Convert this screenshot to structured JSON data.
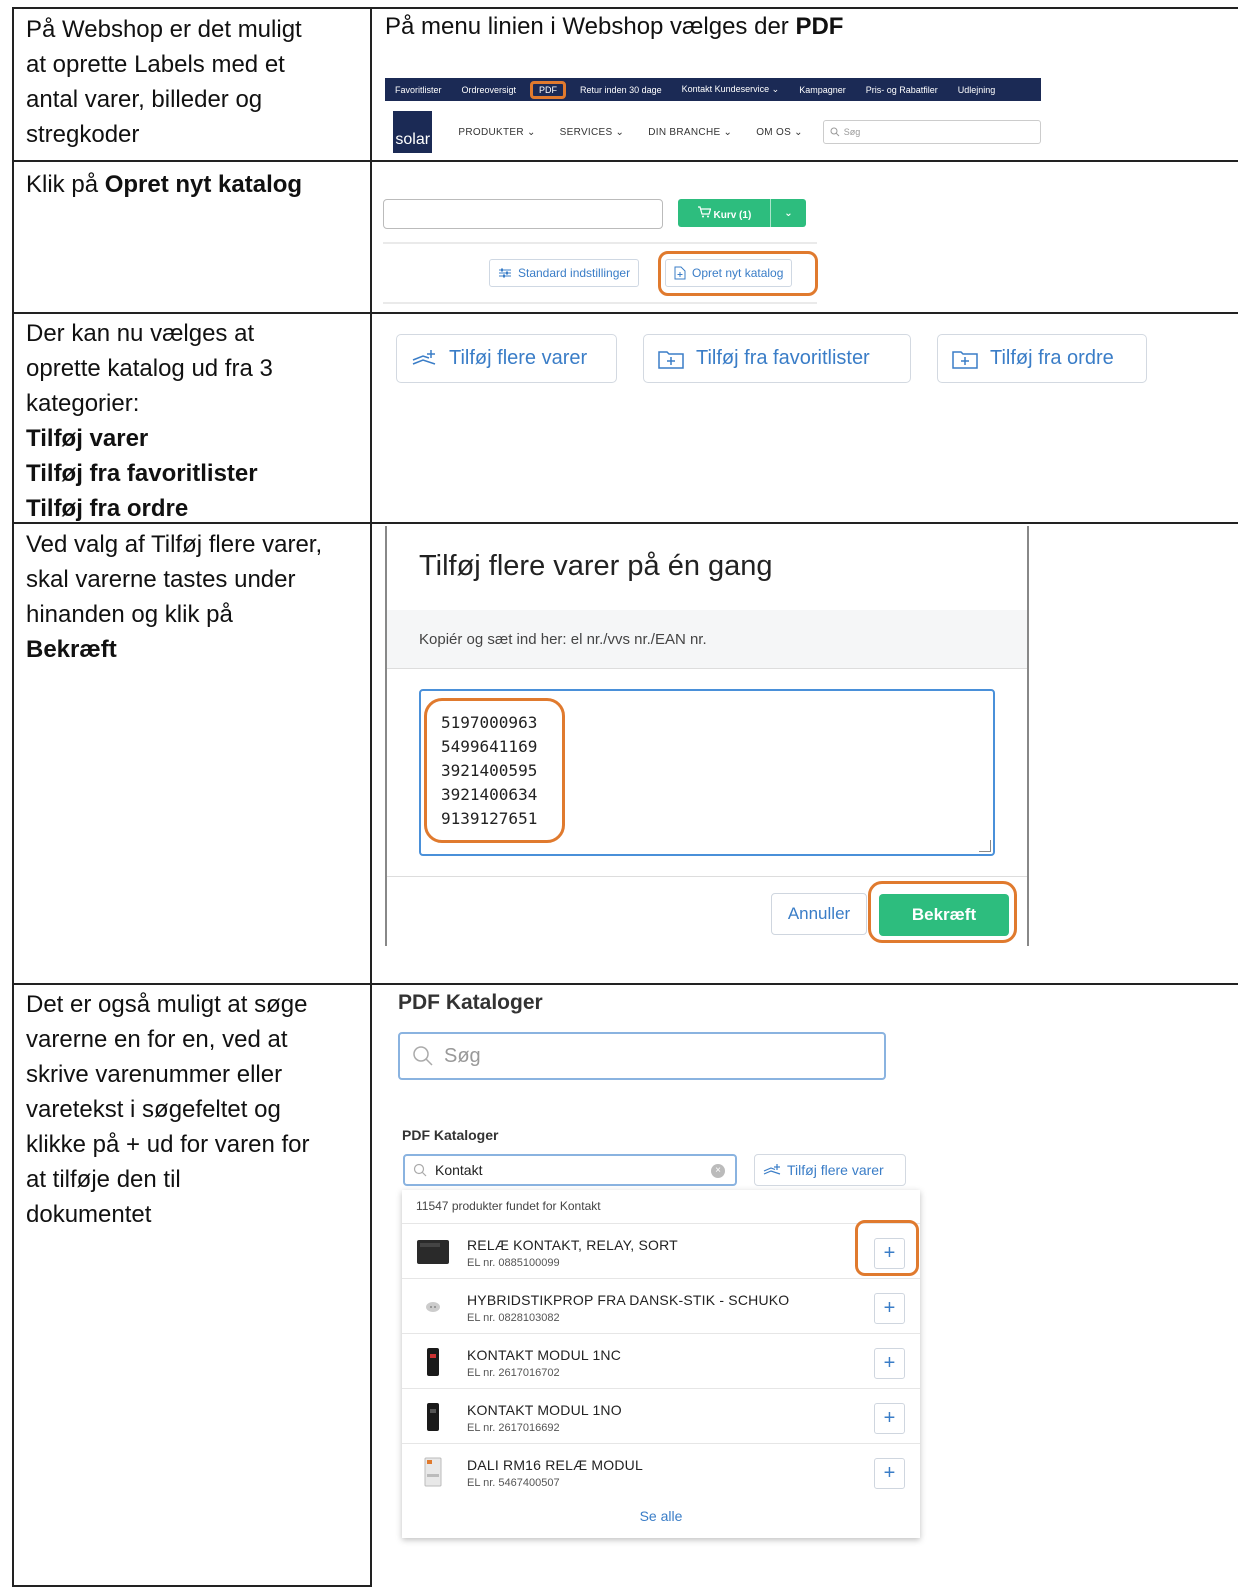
{
  "rows": [
    {
      "left_lines": [
        "På Webshop er det muligt",
        "at oprette Labels med et",
        "antal varer, billeder og",
        "stregkoder"
      ],
      "right_title_prefix": "På menu linien i Webshop vælges der ",
      "right_title_bold": "PDF",
      "nav_items": [
        "Favoritlister",
        "Ordreoversigt",
        "PDF",
        "Retur inden 30 dage",
        "Kontakt Kundeservice ⌄",
        "Kampagner",
        "Pris- og Rabatfiler",
        "Udlejning"
      ],
      "logo": "solar",
      "menu_items": [
        "PRODUKTER ⌄",
        "SERVICES ⌄",
        "DIN BRANCHE ⌄",
        "OM OS ⌄"
      ],
      "search_placeholder": "Søg"
    },
    {
      "left_prefix": "Klik på ",
      "left_bold": "Opret nyt katalog",
      "kurv_label": "Kurv (1)",
      "standard_label": "Standard indstillinger",
      "opret_label": "Opret nyt katalog"
    },
    {
      "left_lines": [
        "Der kan nu vælges at",
        "oprette katalog ud fra 3",
        "kategorier:"
      ],
      "left_bold_lines": [
        "Tilføj varer",
        "Tilføj fra favoritlister",
        "Tilføj fra ordre"
      ],
      "buttons": [
        "Tilføj flere varer",
        "Tilføj fra favoritlister",
        "Tilføj fra ordre"
      ]
    },
    {
      "left_lines": [
        "Ved valg af Tilføj flere varer,",
        "skal varerne tastes under",
        "hinanden og klik på"
      ],
      "left_bold": "Bekræft",
      "dialog_title": "Tilføj flere varer på én gang",
      "dialog_subtitle": "Kopiér og sæt ind her: el nr./vvs nr./EAN nr.",
      "codes": [
        "5197000963",
        "5499641169",
        "3921400595",
        "3921400634",
        "9139127651"
      ],
      "cancel_label": "Annuller",
      "confirm_label": "Bekræft"
    },
    {
      "left_lines": [
        "Det er også muligt at søge",
        "varerne en for en, ved at",
        "skrive varenummer eller",
        "varetekst i søgefeltet og",
        "klikke på + ud for varen for",
        "at tilføje den til",
        "dokumentet"
      ],
      "heading": "PDF Kataloger",
      "search_placeholder": "Søg",
      "heading2": "PDF Kataloger",
      "search_value": "Kontakt",
      "add_more_label": "Tilføj flere varer",
      "results_count": "11547 produkter fundet for Kontakt",
      "products": [
        {
          "name": "RELÆ KONTAKT, RELAY, SORT",
          "el": "EL nr. 0885100099"
        },
        {
          "name": "HYBRIDSTIKPROP FRA DANSK-STIK - SCHUKO",
          "el": "EL nr. 0828103082"
        },
        {
          "name": "KONTAKT MODUL 1NC",
          "el": "EL nr. 2617016702"
        },
        {
          "name": "KONTAKT MODUL 1NO",
          "el": "EL nr. 2617016692"
        },
        {
          "name": "DALI RM16 RELÆ MODUL",
          "el": "EL nr. 5467400507"
        }
      ],
      "plus": "+",
      "see_all": "Se alle"
    }
  ],
  "colors": {
    "highlight": "#e07a2e",
    "accent_green": "#2dbd7e",
    "link_blue": "#3a7dc7",
    "nav_bg": "#1b2a55"
  }
}
